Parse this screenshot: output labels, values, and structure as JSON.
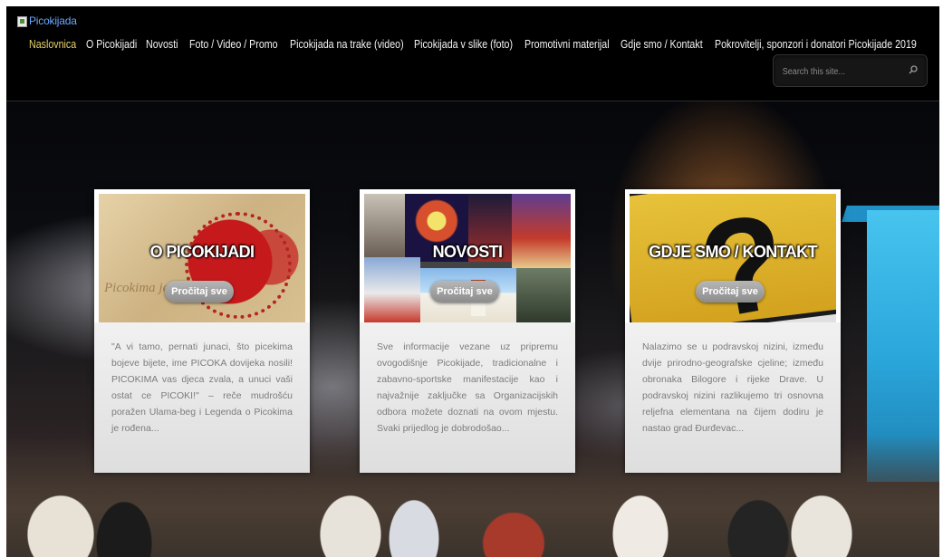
{
  "header": {
    "logo_text": "Picokijada"
  },
  "nav": {
    "items": [
      {
        "label": "Naslovnica",
        "active": true
      },
      {
        "label": "O Picokijadi"
      },
      {
        "label": "Novosti"
      },
      {
        "label": "Foto / Video / Promo"
      },
      {
        "label": "Picokijada na trake (video)"
      },
      {
        "label": "Picokijada v slike (foto)"
      },
      {
        "label": "Promotivni materijal"
      },
      {
        "label": "Gdje smo / Kontakt"
      },
      {
        "label": "Pokrovitelji, sponzori i donatori Picokijade 2019"
      }
    ]
  },
  "search": {
    "placeholder": "Search this site...",
    "icon": "search-icon"
  },
  "cards": [
    {
      "image_title": "O PICOKIJADI",
      "image_script": "Picokima je ... zvala,",
      "text": "\"A vi tamo, pernati junaci, što picekima bojeve bijete, ime PICOKA dovijeka nosili! PICOKIMA vas djeca zvala, a unuci vaši ostat ce PICOKI!\" – reče mudrošću poražen Ulama-beg i Legenda o Picokima je rođena...",
      "button": "Pročitaj sve"
    },
    {
      "image_title": "NOVOSTI",
      "text": "Sve informacije vezane uz pripremu ovogodišnje Picokijade, tradicionalne i zabavno-sportske manifestacije kao i najvažnije zaključke sa Organizacijskih odbora možete doznati na ovom mjestu. Svaki prijedlog je dobrodošao...",
      "button": "Pročitaj sve"
    },
    {
      "image_title": "GDJE SMO / KONTAKT",
      "text": "Nalazimo se u podravskoj nizini, između dvije prirodno-geografske cjeline; između obronaka Bilogore i rijeke Drave. U podravskoj nizini razlikujemo tri osnovna reljefna elementana na čijem dodiru je nastao grad Đurđevac...",
      "button": "Pročitaj sve"
    }
  ],
  "colors": {
    "nav_text": "#f4f4f4",
    "nav_active": "#e9d26a",
    "logo_link": "#6aa9ff",
    "card_text": "#7c7c7c",
    "button_bg": "#9e9e9e"
  }
}
